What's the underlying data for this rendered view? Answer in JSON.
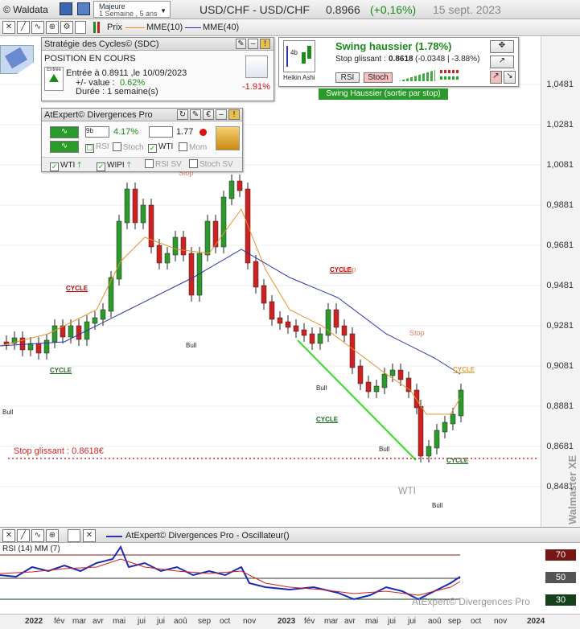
{
  "app": {
    "title": "© Waldata",
    "market_group": "Majeure",
    "period": "1 Semaine , 5 ans"
  },
  "header": {
    "symbol": "USD/CHF - USD/CHF",
    "price": "0.8966",
    "change": "(+0,16%)",
    "date": "15 sept. 2023"
  },
  "toolbar": {
    "price_label": "Prix",
    "mme10": "MME(10)",
    "mme40": "MME(40)",
    "mme10_color": "#e8902a",
    "mme40_color": "#2a34b0"
  },
  "strategy": {
    "title": "Stratégie des Cycles© (SDC)",
    "position": "POSITION EN COURS",
    "entree": "Entrée à 0.8911 ,le 10/09/2023",
    "value_label": "+/- value :",
    "value": "0.62%",
    "duree": "Durée : 1 semaine(s)",
    "perf": "-1.91%",
    "entree_icon_label": "Entrée"
  },
  "swing": {
    "title": "Swing haussier (1.78%)",
    "stop_label": "Stop glissant :",
    "stop_value": "0.8618",
    "stop_delta": "(-0.0348 | -3.88%)",
    "heikin": "Heikin Ashi",
    "rsi_btn": "RSI",
    "stoch_btn": "Stoch",
    "badge": "Swing Haussier (sortie par stop)",
    "ha_count": "4b"
  },
  "expert": {
    "title": "AtExpert© Divergences Pro",
    "pct": "4.17%",
    "count": "1.77",
    "rsi": "RSI",
    "stoch": "Stoch",
    "wti": "WTI",
    "mom": "Mom",
    "wti2": "WTI",
    "wipi": "WIPI",
    "rsi_sv": "RSI SV",
    "stoch_sv": "Stoch SV",
    "ha_label": "9b"
  },
  "yaxis": {
    "labels": [
      "1,0481",
      "1,0281",
      "1,0081",
      "0,9881",
      "0,9681",
      "0,9481",
      "0,9281",
      "0,9081",
      "0,8881",
      "0,8681",
      "0,8481"
    ]
  },
  "annotations": {
    "stop_line": "Stop glissant : 0.8618€",
    "wti": "WTI",
    "cycle": "CYCLE",
    "bull": "Bull",
    "stop": "Stop",
    "watermark": "Walmaster XE",
    "brand": "AtExpert© Divergences Pro"
  },
  "oscillator": {
    "title": "AtExpert© Divergences Pro - Oscillateur()",
    "rsi_label": "RSI (14) MM (7)",
    "levels": [
      "70",
      "50",
      "30"
    ],
    "level_colors": [
      "#7a1515",
      "#555555",
      "#15401a"
    ]
  },
  "xaxis": {
    "labels": [
      "2022",
      "fév",
      "mar",
      "avr",
      "mai",
      "jui",
      "jui",
      "aoû",
      "sep",
      "oct",
      "nov",
      "2023",
      "fév",
      "mar",
      "avr",
      "mai",
      "jui",
      "jui",
      "aoû",
      "sep",
      "oct",
      "nov",
      "2024"
    ]
  }
}
